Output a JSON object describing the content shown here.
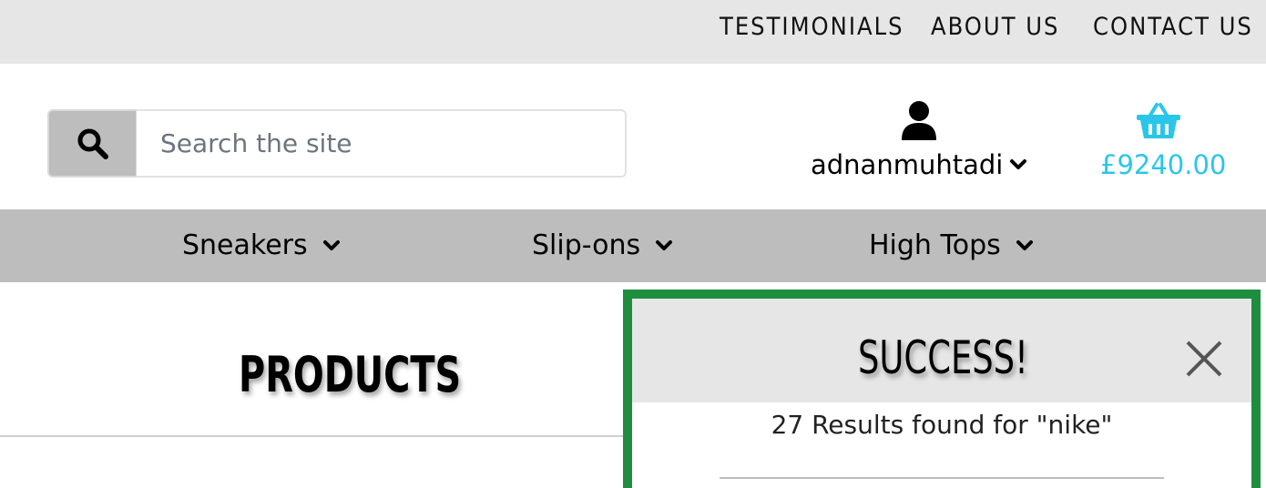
{
  "topbar": {
    "links": [
      {
        "label": "TESTIMONIALS"
      },
      {
        "label": "ABOUT US"
      },
      {
        "label": "CONTACT US"
      }
    ]
  },
  "search": {
    "placeholder": "Search the site",
    "value": "",
    "icon": "search-icon"
  },
  "account": {
    "icon": "user-icon",
    "username": "adnanmuhtadi"
  },
  "basket": {
    "icon": "basket-icon",
    "total": "£9240.00",
    "color": "#2ac6e9"
  },
  "nav": {
    "items": [
      {
        "label": "Sneakers"
      },
      {
        "label": "Slip-ons"
      },
      {
        "label": "High Tops"
      }
    ]
  },
  "page": {
    "title": "PRODUCTS"
  },
  "toast": {
    "title": "SUCCESS!",
    "message": "27 Results found for \"nike\"",
    "border_color": "#1e8e3e"
  }
}
